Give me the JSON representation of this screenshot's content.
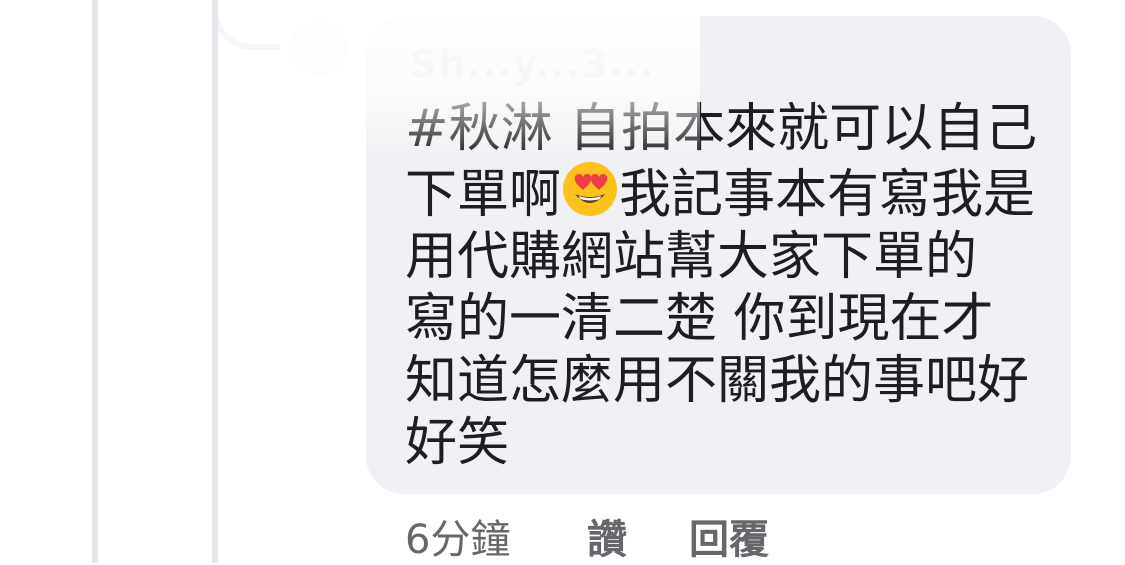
{
  "comment": {
    "author": "Sh...y...3...",
    "text_before_emoji": "#秋淋 自拍本來就可以自己下單啊",
    "emoji": "heart-eyes-emoji",
    "text_after_emoji": "我記事本有寫我是用代購網站幫大家下單的 寫的一清二楚 你到現在才知道怎麼用不關我的事吧好好笑"
  },
  "meta": {
    "timestamp": "6分鐘",
    "like_label": "讚",
    "reply_label": "回覆"
  },
  "colors": {
    "bubble": "#f0f1f4",
    "text": "#1c1e21",
    "meta_text": "#65676b",
    "thread_line": "#e4e6eb"
  }
}
